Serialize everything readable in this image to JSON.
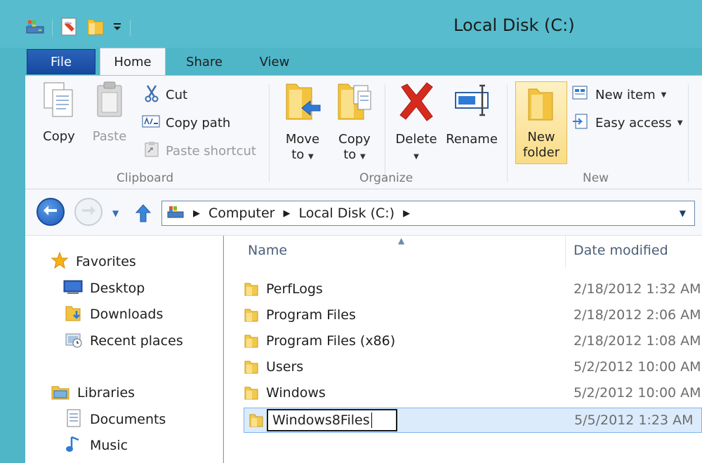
{
  "window": {
    "title": "Local Disk (C:)"
  },
  "ribbon": {
    "tabs": [
      "File",
      "Home",
      "Share",
      "View"
    ],
    "clipboard": {
      "copy": "Copy",
      "paste": "Paste",
      "cut": "Cut",
      "copy_path": "Copy path",
      "paste_shortcut": "Paste shortcut",
      "group_label": "Clipboard"
    },
    "organize": {
      "move_to_1": "Move",
      "move_to_2": "to",
      "copy_to_1": "Copy",
      "copy_to_2": "to",
      "delete": "Delete",
      "rename": "Rename",
      "group_label": "Organize"
    },
    "new": {
      "new_folder_1": "New",
      "new_folder_2": "folder",
      "new_item": "New item",
      "easy_access": "Easy access",
      "group_label": "New"
    }
  },
  "address": {
    "crumbs": [
      "Computer",
      "Local Disk (C:)"
    ]
  },
  "navigation": {
    "favorites": "Favorites",
    "desktop": "Desktop",
    "downloads": "Downloads",
    "recent": "Recent places",
    "libraries": "Libraries",
    "documents": "Documents",
    "music": "Music"
  },
  "files": {
    "col_name": "Name",
    "col_date": "Date modified",
    "rows": [
      {
        "name": "PerfLogs",
        "date": "2/18/2012 1:32 AM"
      },
      {
        "name": "Program Files",
        "date": "2/18/2012 2:06 AM"
      },
      {
        "name": "Program Files (x86)",
        "date": "2/18/2012 1:08 AM"
      },
      {
        "name": "Users",
        "date": "5/2/2012 10:00 AM"
      },
      {
        "name": "Windows",
        "date": "5/2/2012 10:00 AM"
      }
    ],
    "renaming": {
      "name": "Windows8Files",
      "date": "5/5/2012 1:23 AM"
    }
  },
  "colors": {
    "frame": "#57bccd",
    "file_tab": "#1848a0",
    "selection": "#dcebfc",
    "folder": "#f2c94c"
  }
}
